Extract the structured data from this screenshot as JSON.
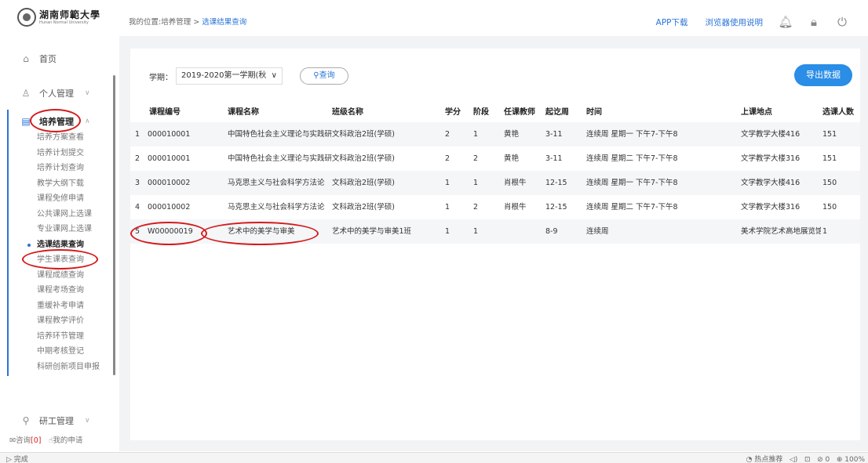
{
  "logo": {
    "name_cn": "湖南师範大學",
    "name_en": "Hunan Normal University"
  },
  "sidebar": {
    "home": "首页",
    "personal": "个人管理",
    "training": "培养管理",
    "research": "研工管理",
    "sub_items": [
      "培养方案查看",
      "培养计划提交",
      "培养计划查询",
      "教学大纲下载",
      "课程免修申请",
      "公共课网上选课",
      "专业课网上选课",
      "选课结果查询",
      "学生课表查询",
      "课程成绩查询",
      "课程考场查询",
      "重缓补考申请",
      "课程教学评价",
      "培养环节管理",
      "中期考核登记",
      "科研创新项目申报"
    ],
    "active_index": 7,
    "bottom_consult": "咨询",
    "bottom_consult_count": "[0]",
    "bottom_my_apply": "我的申请"
  },
  "breadcrumb": {
    "prefix": "我的位置:培养管理 > ",
    "current": "选课结果查询"
  },
  "topbar": {
    "app_download": "APP下载",
    "browser_guide": "浏览器使用说明"
  },
  "filter": {
    "term_label": "学期：",
    "term_value": "2019-2020第一学期(秋",
    "query_label": "查询"
  },
  "export_label": "导出数据",
  "table": {
    "headers": [
      "课程编号",
      "课程名称",
      "班级名称",
      "学分",
      "阶段",
      "任课教师",
      "起讫周",
      "时间",
      "上课地点",
      "选课人数"
    ],
    "rows": [
      {
        "idx": "1",
        "code": "000010001",
        "name": "中国特色社会主义理论与实践研究",
        "class": "文科政治2班(学硕)",
        "credit": "2",
        "stage": "1",
        "teacher": "黄艳",
        "weeks": "3-11",
        "time": "连续周 星期一 下午7-下午8",
        "place": "文学教学大楼416",
        "count": "151"
      },
      {
        "idx": "2",
        "code": "000010001",
        "name": "中国特色社会主义理论与实践研究",
        "class": "文科政治2班(学硕)",
        "credit": "2",
        "stage": "2",
        "teacher": "黄艳",
        "weeks": "3-11",
        "time": "连续周 星期二 下午7-下午8",
        "place": "文学教学大楼316",
        "count": "151"
      },
      {
        "idx": "3",
        "code": "000010002",
        "name": "马克思主义与社会科学方法论",
        "class": "文科政治2班(学硕)",
        "credit": "1",
        "stage": "1",
        "teacher": "肖根牛",
        "weeks": "12-15",
        "time": "连续周 星期一 下午7-下午8",
        "place": "文学教学大楼416",
        "count": "150"
      },
      {
        "idx": "4",
        "code": "000010002",
        "name": "马克思主义与社会科学方法论",
        "class": "文科政治2班(学硕)",
        "credit": "1",
        "stage": "2",
        "teacher": "肖根牛",
        "weeks": "12-15",
        "time": "连续周 星期二 下午7-下午8",
        "place": "文学教学大楼316",
        "count": "150"
      },
      {
        "idx": "5",
        "code": "W00000019",
        "name": "艺术中的美学与审美",
        "class": "艺术中的美学与审美1班",
        "credit": "1",
        "stage": "1",
        "teacher": "",
        "weeks": "8-9",
        "time": "连续周",
        "place": "美术学院艺术高地展览馆",
        "count": "1"
      }
    ]
  },
  "statusbar": {
    "left": "完成",
    "hot": "热点推荐",
    "count": "0",
    "zoom": "100%"
  }
}
